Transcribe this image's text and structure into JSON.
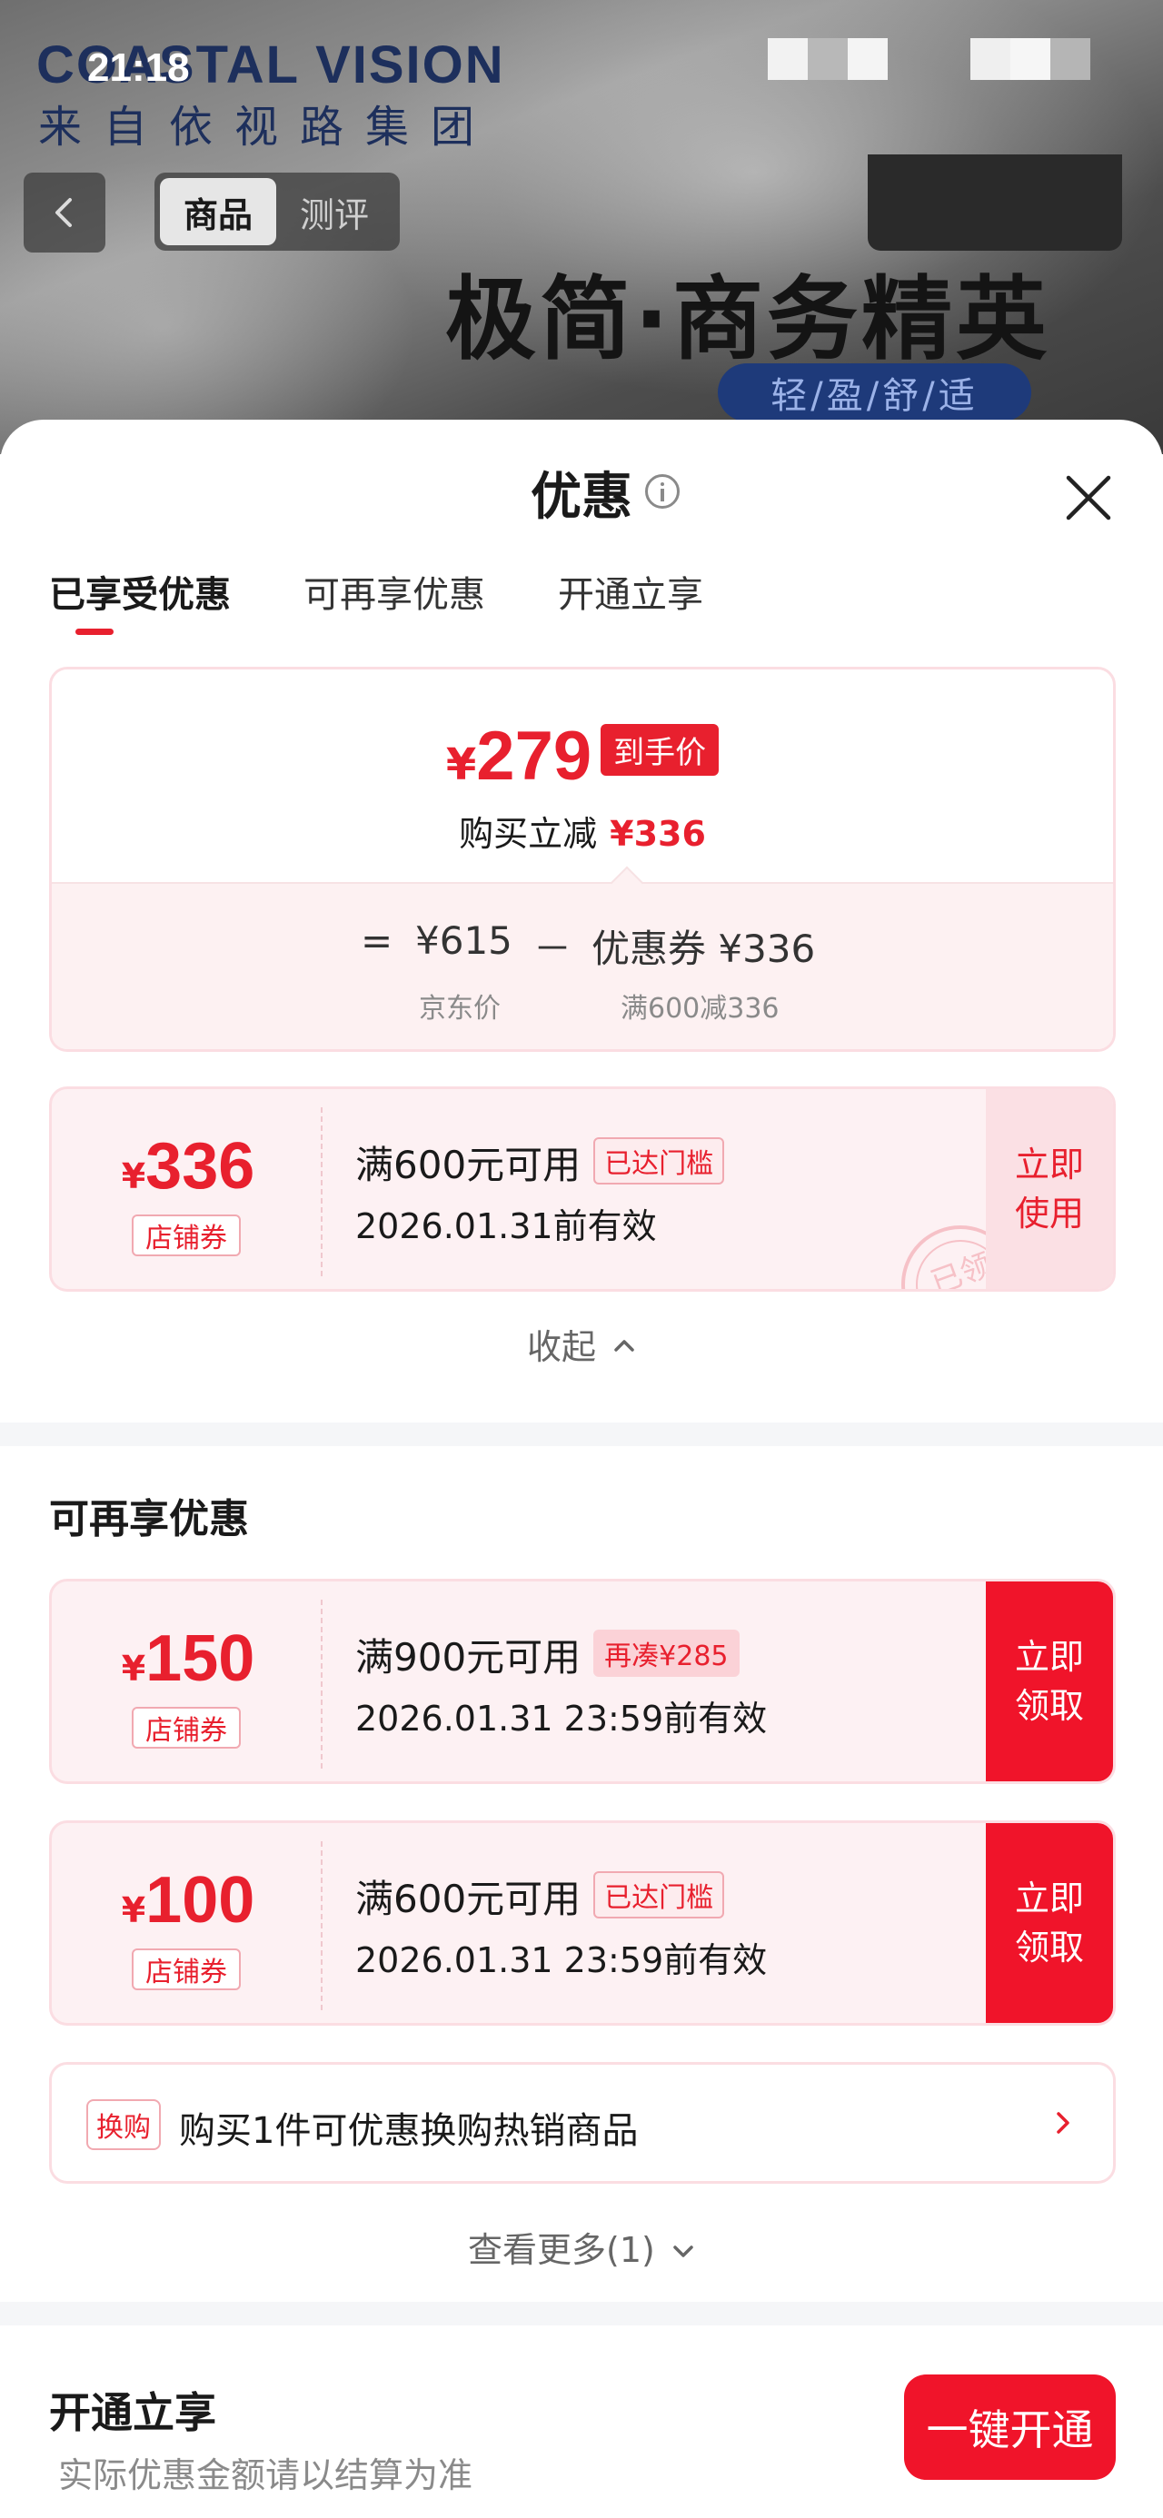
{
  "status_bar": {
    "time": "21:18"
  },
  "product_header": {
    "brand_en": "COASTAL VISION",
    "brand_cn": "来自依视路集团",
    "tabs": [
      {
        "label": "商品",
        "active": true
      },
      {
        "label": "测评",
        "active": false
      }
    ],
    "slogan": "极简·商务精英",
    "slogan_sub": "轻/盈/舒/适"
  },
  "sheet": {
    "title": "优惠",
    "tabs": [
      {
        "label": "已享受优惠",
        "active": true
      },
      {
        "label": "可再享优惠",
        "active": false
      },
      {
        "label": "开通立享",
        "active": false
      }
    ],
    "price_summary": {
      "currency": "¥",
      "final_price": "279",
      "final_badge": "到手价",
      "reduce_label": "购买立减",
      "reduce_amount": "¥336",
      "equals": "=",
      "jd_price": "¥615",
      "minus": "－",
      "coupon_label": "优惠券 ¥336",
      "jd_price_label": "京东价",
      "coupon_rule": "满600减336"
    },
    "applied_coupon": {
      "currency": "¥",
      "amount": "336",
      "type": "店铺券",
      "condition": "满600元可用",
      "badge": "已达门槛",
      "validity": "2026.01.31前有效",
      "action": "立即\n使用",
      "stamp": "已领"
    },
    "collapse_label": "收起",
    "more_section": {
      "title": "可再享优惠",
      "coupons": [
        {
          "currency": "¥",
          "amount": "150",
          "type": "店铺券",
          "condition": "满900元可用",
          "badge": "再凑¥285",
          "validity": "2026.01.31 23:59前有效",
          "action": "立即\n领取"
        },
        {
          "currency": "¥",
          "amount": "100",
          "type": "店铺券",
          "condition": "满600元可用",
          "badge": "已达门槛",
          "validity": "2026.01.31 23:59前有效",
          "action": "立即\n领取"
        }
      ],
      "exchange": {
        "tag": "换购",
        "text": "购买1件可优惠换购热销商品"
      },
      "see_more": "查看更多(1)"
    },
    "open_section": {
      "title": "开通立享",
      "note": "实际优惠金额请以结算为准",
      "button": "一键开通"
    }
  },
  "colors": {
    "accent": "#e8202e",
    "button_red": "#f0142a",
    "card_border": "#fbdde2",
    "card_bg": "#fdf1f3"
  }
}
